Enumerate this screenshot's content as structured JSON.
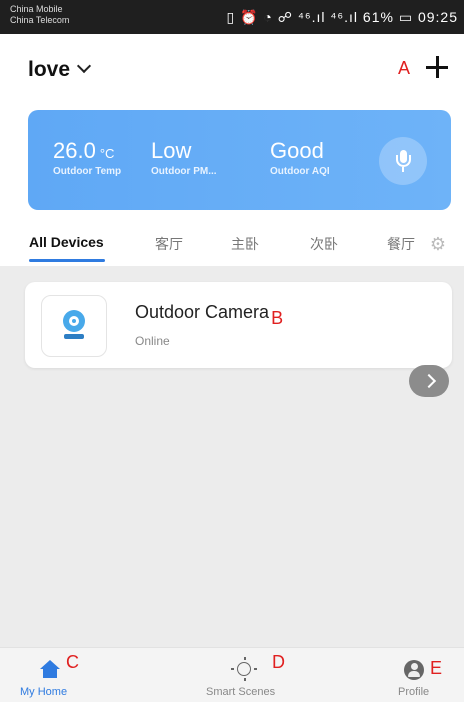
{
  "status_bar": {
    "carrier1": "China Mobile",
    "carrier2": "China Telecom",
    "right": "▯ ⏰ ◔ ☍ ⁴⁶.ıl ⁴⁶.ıl 61% ▭ 09:25"
  },
  "header": {
    "home_name": "love",
    "label_a": "A"
  },
  "weather": {
    "temp": "26.0",
    "temp_unit": "°C",
    "temp_label": "Outdoor Temp",
    "pm": "Low",
    "pm_label": "Outdoor PM...",
    "aqi": "Good",
    "aqi_label": "Outdoor AQI"
  },
  "tabs": [
    "All Devices",
    "客厅",
    "主卧",
    "次卧",
    "餐厅"
  ],
  "device": {
    "name": "Outdoor Camera",
    "status": "Online",
    "label_b": "B"
  },
  "bottom_nav": {
    "home": "My Home",
    "scenes": "Smart Scenes",
    "profile": "Profile",
    "label_c": "C",
    "label_d": "D",
    "label_e": "E"
  },
  "colors": {
    "accent": "#2f7be0",
    "weather_card": "#64abf6",
    "annotation": "#e02020"
  },
  "icons": [
    "add-icon",
    "chevron-down-icon",
    "mic-icon",
    "gear-icon",
    "camera-icon",
    "chevron-right-icon",
    "home-icon",
    "sun-icon",
    "profile-icon"
  ]
}
